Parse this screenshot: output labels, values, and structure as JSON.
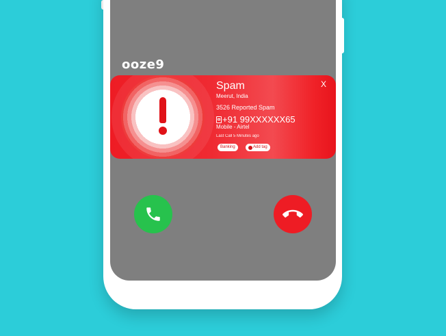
{
  "brand": {
    "logo": "ooze9"
  },
  "caller_card": {
    "label": "Spam",
    "location": "Meerut, India",
    "reports": "3526 Reported Spam",
    "number": "+91 99XXXXXX65",
    "carrier": "Mobile - Airtel",
    "last_call": "Last Call 5 Minutes ago",
    "tags": [
      "Banking"
    ],
    "add_tag_label": "Add tag",
    "close_label": "X",
    "warning_icon": "exclamation-icon"
  },
  "actions": {
    "accept_icon": "phone-icon",
    "decline_icon": "phone-hangup-icon"
  },
  "colors": {
    "background": "#2ccdd9",
    "screen": "#7f7f7f",
    "spam_red": "#ee1c24",
    "accept_green": "#27c24d"
  }
}
